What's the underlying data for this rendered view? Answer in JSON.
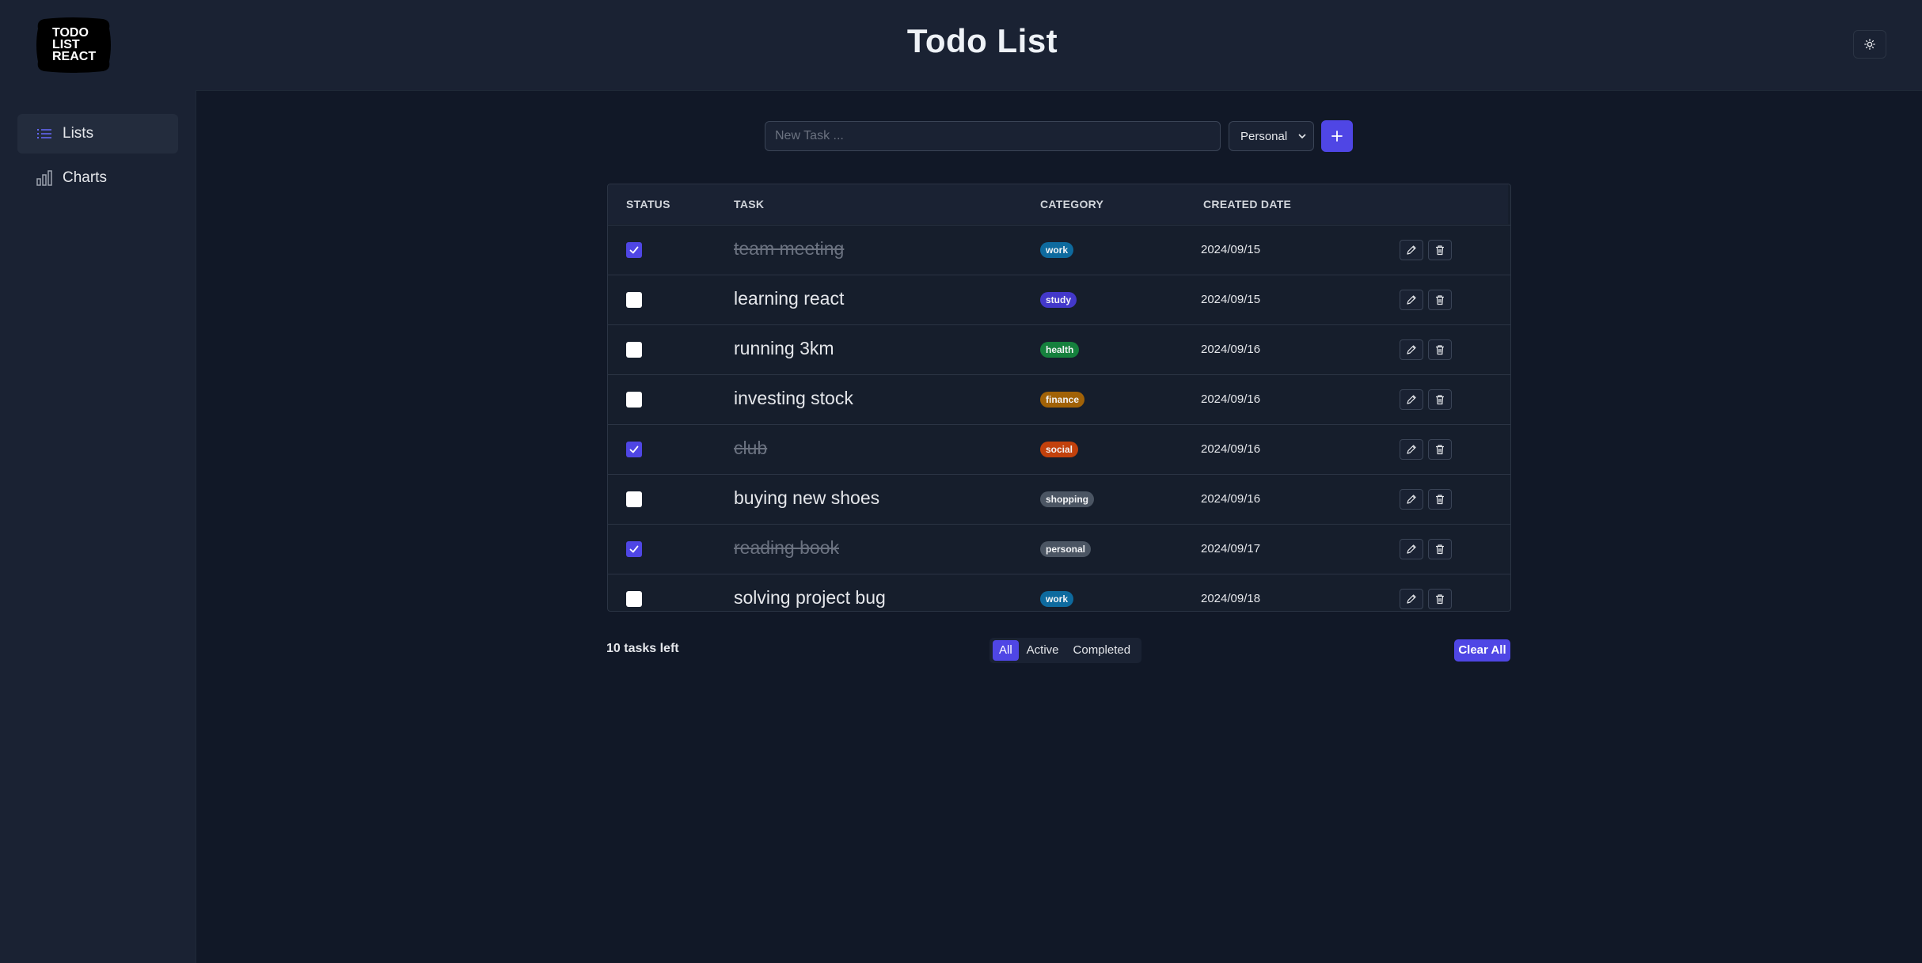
{
  "app": {
    "title": "Todo List",
    "logo_text": [
      "TODO",
      "LIST",
      "REACT"
    ]
  },
  "sidebar": {
    "items": [
      {
        "label": "Lists",
        "icon": "list-icon",
        "active": true
      },
      {
        "label": "Charts",
        "icon": "bar-chart-icon",
        "active": false
      }
    ]
  },
  "composer": {
    "placeholder": "New Task ...",
    "category_selected": "Personal",
    "add_icon": "plus-icon"
  },
  "table": {
    "headers": [
      "STATUS",
      "TASK",
      "CATEGORY",
      "CREATED DATE"
    ],
    "rows": [
      {
        "done": true,
        "task": "team meeting",
        "category": "work",
        "color": "#0e6a9e",
        "date": "2024/09/15"
      },
      {
        "done": false,
        "task": "learning react",
        "category": "study",
        "color": "#4338ca",
        "date": "2024/09/15"
      },
      {
        "done": false,
        "task": "running 3km",
        "category": "health",
        "color": "#15803d",
        "date": "2024/09/16"
      },
      {
        "done": false,
        "task": "investing stock",
        "category": "finance",
        "color": "#a16207",
        "date": "2024/09/16"
      },
      {
        "done": true,
        "task": "club",
        "category": "social",
        "color": "#c2410c",
        "date": "2024/09/16"
      },
      {
        "done": false,
        "task": "buying new shoes",
        "category": "shopping",
        "color": "#4b5563",
        "date": "2024/09/16"
      },
      {
        "done": true,
        "task": "reading book",
        "category": "personal",
        "color": "#4b5563",
        "date": "2024/09/17"
      },
      {
        "done": false,
        "task": "solving project bug",
        "category": "work",
        "color": "#0e6a9e",
        "date": "2024/09/18"
      }
    ]
  },
  "footer": {
    "tasks_left": "10 tasks left",
    "filters": [
      {
        "label": "All",
        "active": true
      },
      {
        "label": "Active",
        "active": false
      },
      {
        "label": "Completed",
        "active": false
      }
    ],
    "clear_label": "Clear All"
  },
  "colors": {
    "accent": "#4f46e5",
    "background": "#111827",
    "panel": "#1a2233"
  }
}
